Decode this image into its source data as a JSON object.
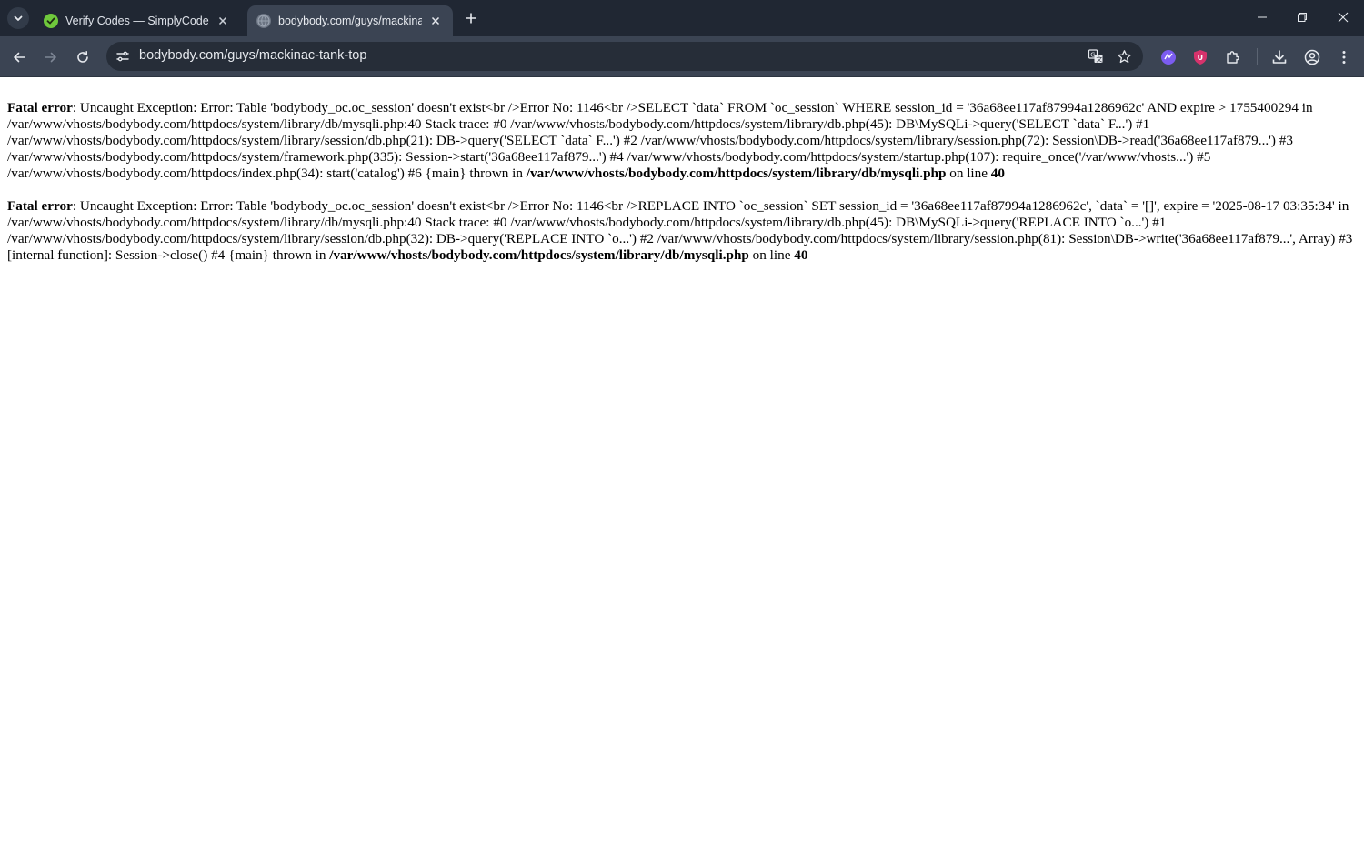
{
  "browser": {
    "tabs": [
      {
        "title": "Verify Codes — SimplyCodes",
        "active": false,
        "favicon": "simplycodes-logo-icon"
      },
      {
        "title": "bodybody.com/guys/mackinac-tank-top",
        "active": true,
        "favicon": "globe-icon"
      }
    ],
    "address_bar": {
      "url": "bodybody.com/guys/mackinac-tank-top"
    },
    "colors": {
      "tabstrip": "#202733",
      "toolbar": "#3b4453",
      "omnibox": "#262d38",
      "simplycodes_green": "#6fc93c",
      "ext_purple": "#7b5cf0",
      "ext_red": "#d6336c"
    }
  },
  "page": {
    "errors": [
      {
        "label": "Fatal error",
        "message": ": Uncaught Exception: Error: Table 'bodybody_oc.oc_session' doesn't exist<br />Error No: 1146<br />SELECT `data` FROM `oc_session` WHERE session_id = '36a68ee117af87994a1286962c' AND expire > 1755400294 in /var/www/vhosts/bodybody.com/httpdocs/system/library/db/mysqli.php:40 Stack trace: #0 /var/www/vhosts/bodybody.com/httpdocs/system/library/db.php(45): DB\\MySQLi->query('SELECT `data` F...') #1 /var/www/vhosts/bodybody.com/httpdocs/system/library/session/db.php(21): DB->query('SELECT `data` F...') #2 /var/www/vhosts/bodybody.com/httpdocs/system/library/session.php(72): Session\\DB->read('36a68ee117af879...') #3 /var/www/vhosts/bodybody.com/httpdocs/system/framework.php(335): Session->start('36a68ee117af879...') #4 /var/www/vhosts/bodybody.com/httpdocs/system/startup.php(107): require_once('/var/www/vhosts...') #5 /var/www/vhosts/bodybody.com/httpdocs/index.php(34): start('catalog') #6 {main} thrown in ",
        "file": "/var/www/vhosts/bodybody.com/httpdocs/system/library/db/mysqli.php",
        "on_line_text": " on line ",
        "line": "40"
      },
      {
        "label": "Fatal error",
        "message": ": Uncaught Exception: Error: Table 'bodybody_oc.oc_session' doesn't exist<br />Error No: 1146<br />REPLACE INTO `oc_session` SET session_id = '36a68ee117af87994a1286962c', `data` = '[]', expire = '2025-08-17 03:35:34' in /var/www/vhosts/bodybody.com/httpdocs/system/library/db/mysqli.php:40 Stack trace: #0 /var/www/vhosts/bodybody.com/httpdocs/system/library/db.php(45): DB\\MySQLi->query('REPLACE INTO `o...') #1 /var/www/vhosts/bodybody.com/httpdocs/system/library/session/db.php(32): DB->query('REPLACE INTO `o...') #2 /var/www/vhosts/bodybody.com/httpdocs/system/library/session.php(81): Session\\DB->write('36a68ee117af879...', Array) #3 [internal function]: Session->close() #4 {main} thrown in ",
        "file": "/var/www/vhosts/bodybody.com/httpdocs/system/library/db/mysqli.php",
        "on_line_text": " on line ",
        "line": "40"
      }
    ]
  }
}
